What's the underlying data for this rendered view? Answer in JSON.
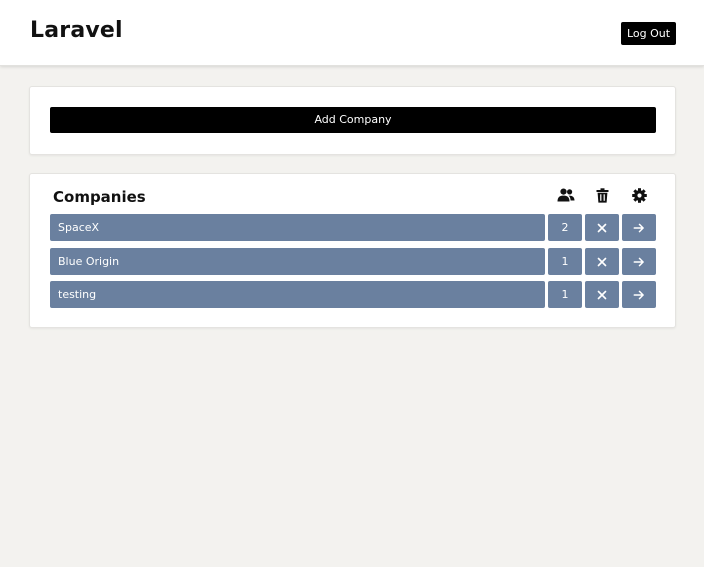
{
  "header": {
    "brand": "Laravel",
    "logout_label": "Log Out"
  },
  "add_card": {
    "add_label": "Add Company"
  },
  "companies_card": {
    "title": "Companies",
    "header_icons": [
      "users-icon",
      "trash-icon",
      "gear-icon"
    ],
    "rows": [
      {
        "name": "SpaceX",
        "count": "2"
      },
      {
        "name": "Blue Origin",
        "count": "1"
      },
      {
        "name": "testing",
        "count": "1"
      }
    ]
  },
  "colors": {
    "background": "#f3f2ef",
    "row_accent": "#6a809f",
    "button": "#000000"
  }
}
